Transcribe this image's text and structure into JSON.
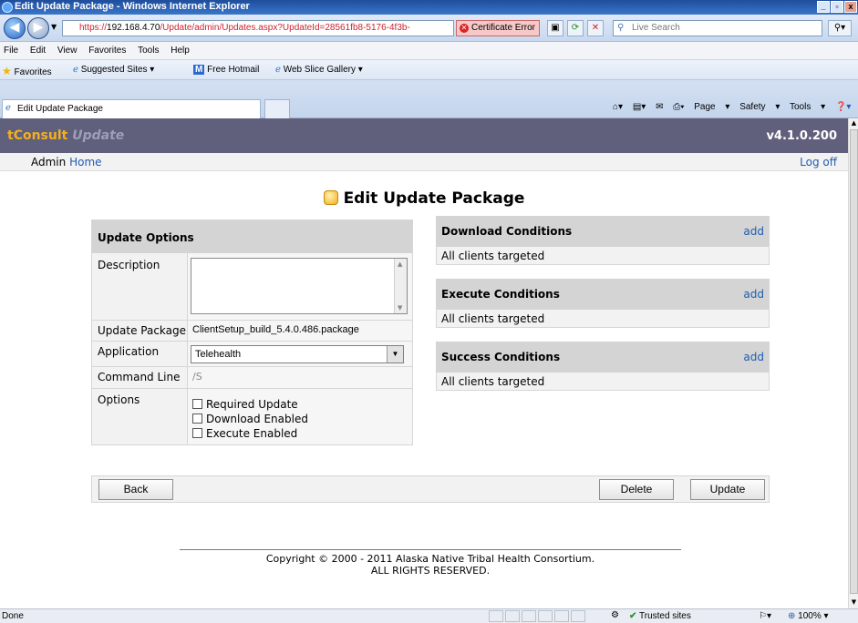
{
  "window": {
    "title": "Edit Update Package - Windows Internet Explorer"
  },
  "browser": {
    "address": {
      "prefix": "https://",
      "host": "192.168.4.70",
      "path": "/Update/admin/Updates.aspx?UpdateId=28561fb8-5176-4f3b-"
    },
    "certificate_error": "Certificate Error",
    "search_placeholder": "Live Search",
    "menu": [
      "File",
      "Edit",
      "View",
      "Favorites",
      "Tools",
      "Help"
    ],
    "favorites_bar": {
      "favorites": "Favorites",
      "suggested": "Suggested Sites",
      "hotmail": "Free Hotmail",
      "slice": "Web Slice Gallery"
    },
    "tab_title": "Edit Update Package",
    "commands": {
      "page": "Page",
      "safety": "Safety",
      "tools": "Tools"
    },
    "status": {
      "left": "Done",
      "zone": "Trusted sites",
      "zoom": "100%"
    }
  },
  "app": {
    "brand": "tConsult",
    "brand_sub": "Update",
    "version": "v4.1.0.200",
    "nav_prefix": "Admin",
    "nav_home": "Home",
    "logoff": "Log off"
  },
  "page": {
    "title": "Edit Update Package"
  },
  "update_options": {
    "header": "Update Options",
    "description_label": "Description",
    "description_value": "",
    "package_label": "Update Package",
    "package_value": "ClientSetup_build_5.4.0.486.package",
    "application_label": "Application",
    "application_value": "Telehealth",
    "command_label": "Command Line",
    "command_value": "/S",
    "options_label": "Options",
    "options": [
      {
        "label": "Required Update",
        "checked": false
      },
      {
        "label": "Download Enabled",
        "checked": false
      },
      {
        "label": "Execute Enabled",
        "checked": false
      }
    ]
  },
  "conditions": [
    {
      "title": "Download Conditions",
      "action": "add",
      "body": "All clients targeted"
    },
    {
      "title": "Execute Conditions",
      "action": "add",
      "body": "All clients targeted"
    },
    {
      "title": "Success Conditions",
      "action": "add",
      "body": "All clients targeted"
    }
  ],
  "actions": {
    "back": "Back",
    "delete": "Delete",
    "update": "Update"
  },
  "footer": {
    "line1": "Copyright © 2000 - 2011 Alaska Native Tribal Health Consortium.",
    "line2": "ALL RIGHTS RESERVED."
  }
}
